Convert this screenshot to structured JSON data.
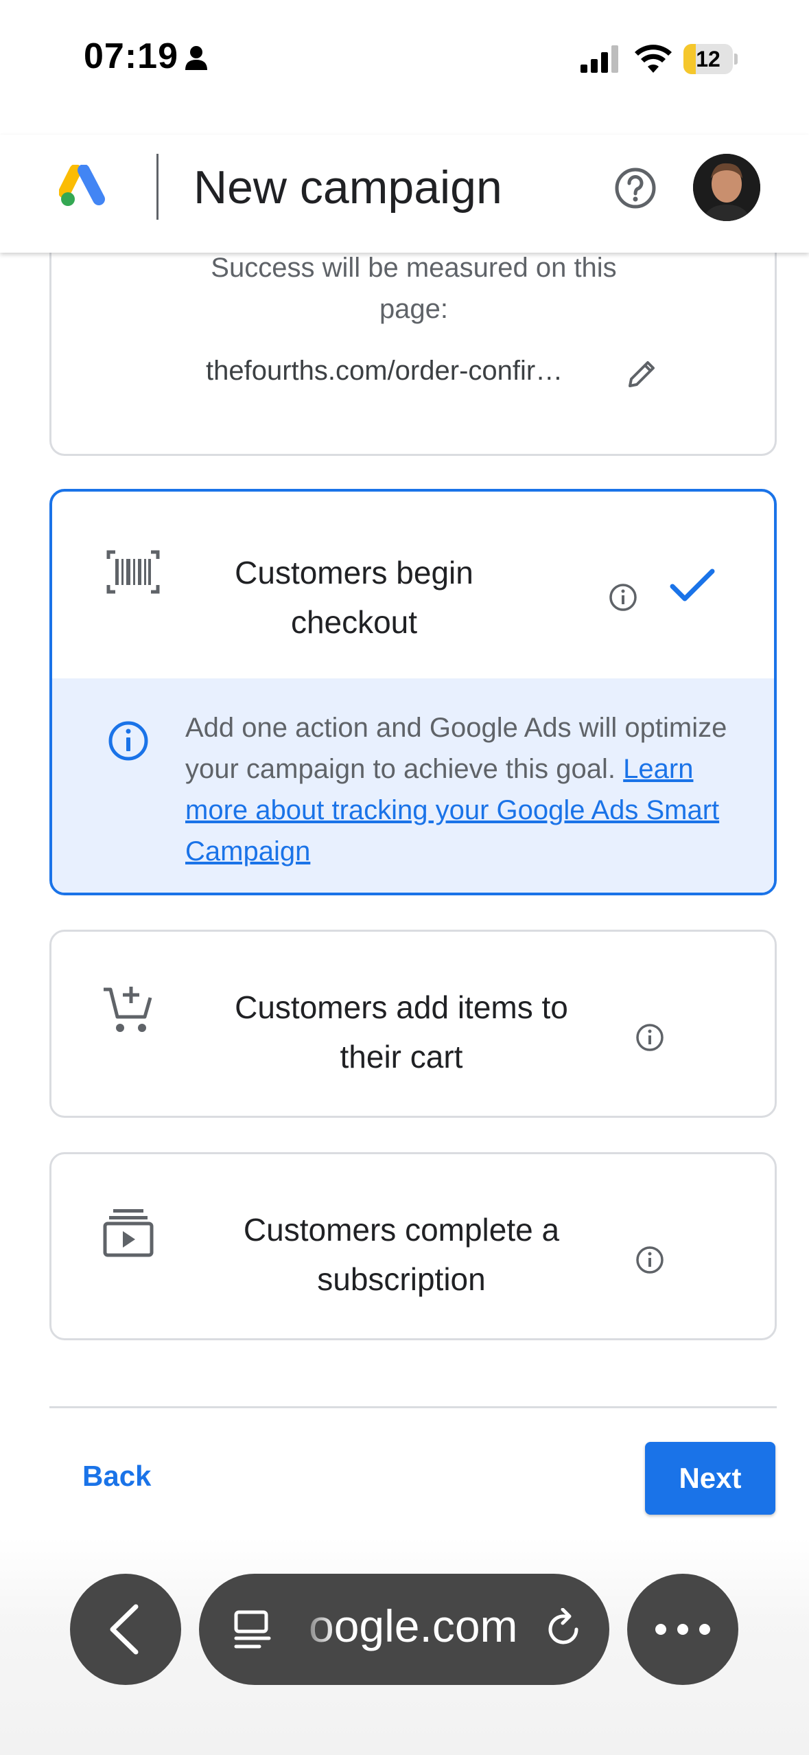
{
  "status_bar": {
    "time": "07:19",
    "battery": "12"
  },
  "header": {
    "title": "New campaign"
  },
  "top_card": {
    "measured_line1": "Success will be measured on this",
    "measured_line2": "page:",
    "url": "thefourths.com/order-confir…"
  },
  "selected_card": {
    "title_line1": "Customers begin",
    "title_line2": "checkout",
    "info_text": "Add one action and Google Ads will optimize your campaign to achieve this goal.",
    "link_text": "Learn more about tracking your Google Ads Smart Campaign"
  },
  "option_cart": {
    "title_line1": "Customers add items to",
    "title_line2": "their cart"
  },
  "option_subscription": {
    "title_line1": "Customers complete a",
    "title_line2": "subscription"
  },
  "footer": {
    "back_label": "Back",
    "next_label": "Next"
  },
  "browser": {
    "url": "oogle.com"
  },
  "colors": {
    "accent": "#1a73e8",
    "info_bg": "#e8f0fe",
    "border": "#dadce0"
  }
}
